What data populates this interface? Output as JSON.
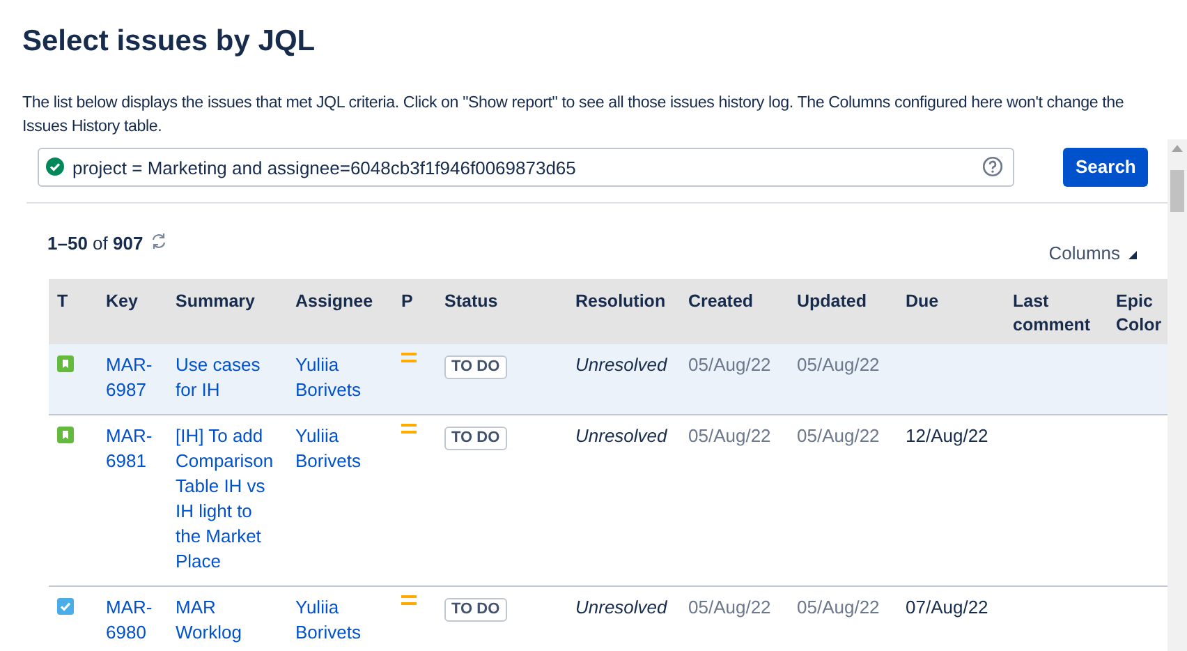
{
  "title": "Select issues by JQL",
  "description": "The list below displays the issues that met JQL criteria. Click on \"Show report\" to see all those issues history log. The Columns configured here won't change the Issues History table.",
  "jql": {
    "value": "project = Marketing and assignee=6048cb3f1f946f0069873d65",
    "valid": true
  },
  "search_button": "Search",
  "count": {
    "range": "1–50",
    "of": "of",
    "total": "907"
  },
  "columns_button": "Columns",
  "table": {
    "columns": [
      "T",
      "Key",
      "Summary",
      "Assignee",
      "P",
      "Status",
      "Resolution",
      "Created",
      "Updated",
      "Due",
      "Last comment",
      "Epic Color"
    ],
    "rows": [
      {
        "selected": true,
        "kind": "story",
        "key": "MAR-6987",
        "summary": "Use cases for IH",
        "assignee": "Yuliia Borivets",
        "priority": {
          "kind": "medium"
        },
        "status": "TO DO",
        "resolution": "Unresolved",
        "created": "05/Aug/22",
        "updated": "05/Aug/22"
      },
      {
        "selected": false,
        "kind": "story",
        "key": "MAR-6981",
        "summary": "[IH] To add Comparison Table IH vs IH light to the Market Place",
        "assignee": "Yuliia Borivets",
        "priority": {
          "kind": "medium"
        },
        "status": "TO DO",
        "resolution": "Unresolved",
        "created": "05/Aug/22",
        "updated": "05/Aug/22",
        "due": "12/Aug/22"
      },
      {
        "selected": false,
        "kind": "task",
        "key": "MAR-6980",
        "summary": "MAR Worklog",
        "assignee": "Yuliia Borivets",
        "priority": {
          "kind": "medium"
        },
        "status": "TO DO",
        "resolution": "Unresolved",
        "created": "05/Aug/22",
        "updated": "05/Aug/22",
        "due": "07/Aug/22"
      }
    ]
  }
}
